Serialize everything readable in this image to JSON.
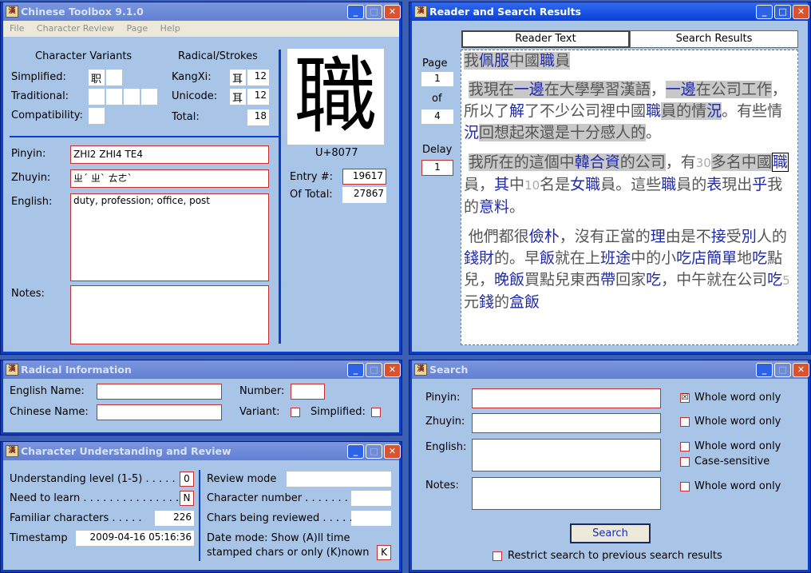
{
  "windows": {
    "toolbox": {
      "title": "Chinese Toolbox  9.1.0"
    },
    "reader": {
      "title": "Reader and Search Results"
    },
    "radical": {
      "title": "Radical Information"
    },
    "understanding": {
      "title": "Character Understanding and Review"
    },
    "search": {
      "title": "Search"
    }
  },
  "toolbox": {
    "menu": [
      "File",
      "Character Review",
      "Page",
      "Help"
    ],
    "variants": {
      "heading": "Character Variants",
      "simplified_label": "Simplified:",
      "simplified_chars": [
        "职",
        ""
      ],
      "traditional_label": "Traditional:",
      "compatibility_label": "Compatibility:"
    },
    "radical": {
      "heading": "Radical/Strokes",
      "kangxi_label": "KangXi:",
      "kangxi_radical": "耳",
      "kangxi_strokes": "12",
      "unicode_label": "Unicode:",
      "unicode_radical": "耳",
      "unicode_strokes": "12",
      "total_label": "Total:",
      "total_strokes": "18"
    },
    "character": "職",
    "codepoint": "U+8077",
    "entry_label": "Entry #:",
    "entry_value": "19617",
    "of_total_label": "Of Total:",
    "of_total_value": "27867",
    "pinyin_label": "Pinyin:",
    "pinyin": "ZHI2 ZHI4 TE4",
    "zhuyin_label": "Zhuyin:",
    "zhuyin": "ㄓˊ ㄓˋ ㄊㄜˋ",
    "english_label": "English:",
    "english": "duty, profession; office, post",
    "notes_label": "Notes:"
  },
  "reader": {
    "tab_reader": "Reader Text",
    "tab_search": "Search Results",
    "page_label": "Page",
    "page_value": "1",
    "of_label": "of",
    "of_value": "4",
    "delay_label": "Delay",
    "delay_value": "1",
    "title_plain1": "我",
    "title_blue1": "佩服",
    "title_plain2": "中國",
    "title_blue2": "職",
    "title_plain3": "員",
    "p1": {
      "a": "我現在",
      "b": "一邊",
      "c": "在大學學習漢語",
      "d": "，",
      "e": "一邊",
      "f": "在公",
      "g": "司工作",
      "h": "，所以了",
      "i": "解",
      "j": "了不少公司裡中國",
      "k": "職",
      "l": "員的情",
      "m": "況",
      "n": "。有些情",
      "o": "況",
      "p": "回想起來還是十分",
      "q": "感人的",
      "r": "。"
    },
    "p2": {
      "a": "我所在的這個中",
      "b": "韓合資",
      "c": "的公司",
      "d": "，有",
      "e": "30",
      "f": "多",
      "g": "名中國",
      "h": "職",
      "i": "員",
      "j": "，",
      "k": "其",
      "l": "中",
      "m": "10",
      "n": "名是",
      "o": "女職",
      "p": "員。這些",
      "q": "職",
      "r": "員的",
      "s": "表",
      "t": "現出",
      "u": "乎",
      "v": "我的",
      "w": "意料",
      "x": "。"
    },
    "p3": {
      "a": "他們都很",
      "b": "儉朴",
      "c": "，沒有正當的",
      "d": "理",
      "e": "由是不",
      "f": "接",
      "g": "受",
      "h": "別",
      "i": "人的",
      "j": "錢財",
      "k": "的。早",
      "l": "飯",
      "m": "就在上",
      "n": "班途",
      "o": "中的",
      "p": "小",
      "q": "吃店簡單",
      "r": "地",
      "s": "吃",
      "t": "點兒，",
      "u": "晚飯",
      "v": "買點兒東西",
      "w": "帶",
      "x": "回家",
      "y": "吃",
      "z": "，中午就在公司",
      "aa": "吃",
      "ab": "5",
      "ac": "元",
      "ad": "錢",
      "ae": "的",
      "af": "盒飯"
    }
  },
  "radical_info": {
    "english_name_label": "English Name:",
    "chinese_name_label": "Chinese Name:",
    "number_label": "Number:",
    "variant_label": "Variant:",
    "simplified_label": "Simplified:"
  },
  "understanding": {
    "level_label": "Understanding level (1-5) . . . . .",
    "level_value": "0",
    "need_label": "Need to learn . . . . . . . . . . . . . . .",
    "need_value": "N",
    "familiar_label": "Familiar characters . . . . .",
    "familiar_value": "226",
    "timestamp_label": "Timestamp",
    "timestamp_value": "2009-04-16 05:16:36",
    "review_mode_label": "Review mode",
    "char_number_label": "Character number . . . . . . .",
    "chars_reviewed_label": "Chars being reviewed . . . . .",
    "date_mode_line1": "Date mode: Show (A)ll time",
    "date_mode_line2": "stamped chars or only (K)nown",
    "date_mode_value": "K"
  },
  "search": {
    "pinyin_label": "Pinyin:",
    "zhuyin_label": "Zhuyin:",
    "english_label": "English:",
    "notes_label": "Notes:",
    "whole_word_pinyin": "Whole word only",
    "whole_word_zhuyin": "Whole word only",
    "whole_word_english": "Whole word only",
    "case_sensitive": "Case-sensitive",
    "whole_word_notes": "Whole word only",
    "search_button": "Search",
    "restrict_label": "Restrict search to previous search results",
    "pinyin_whole_checked": "☒"
  }
}
